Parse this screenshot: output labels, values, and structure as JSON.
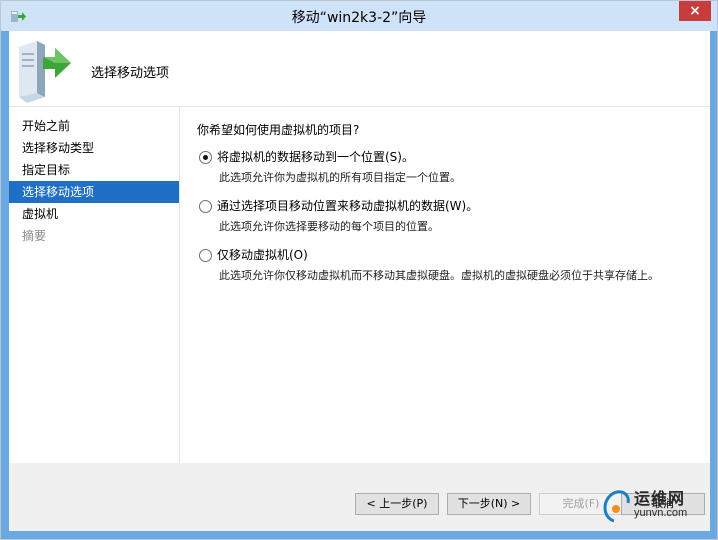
{
  "window": {
    "title": "移动“win2k3-2”向导",
    "close_label": "×"
  },
  "header": {
    "title": "选择移动选项"
  },
  "nav": {
    "items": [
      {
        "label": "开始之前"
      },
      {
        "label": "选择移动类型"
      },
      {
        "label": "指定目标"
      },
      {
        "label": "选择移动选项"
      },
      {
        "label": "虚拟机"
      },
      {
        "label": "摘要"
      }
    ]
  },
  "main": {
    "question": "你希望如何使用虚拟机的项目?",
    "options": [
      {
        "label": "将虚拟机的数据移动到一个位置(S)。",
        "description": "此选项允许你为虚拟机的所有项目指定一个位置。"
      },
      {
        "label": "通过选择项目移动位置来移动虚拟机的数据(W)。",
        "description": "此选项允许你选择要移动的每个项目的位置。"
      },
      {
        "label": "仅移动虚拟机(O)",
        "description": "此选项允许你仅移动虚拟机而不移动其虚拟硬盘。虚拟机的虚拟硬盘必须位于共享存储上。"
      }
    ]
  },
  "footer": {
    "prev_label": "< 上一步(P)",
    "next_label": "下一步(N) >",
    "finish_label": "完成(F)",
    "cancel_label": "取消"
  },
  "watermark": {
    "text_top": "运维网",
    "text_bottom": "yunvn.com"
  }
}
